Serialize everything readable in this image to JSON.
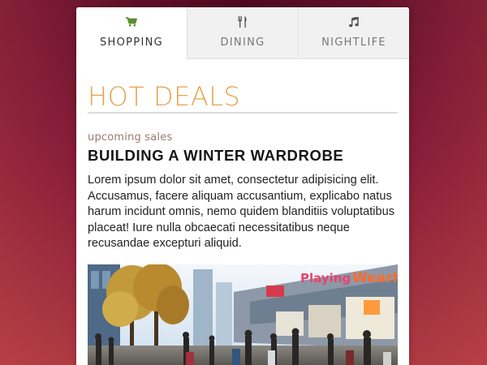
{
  "tabs": [
    {
      "label": "SHOPPING",
      "icon": "shopping-cart-icon",
      "active": true
    },
    {
      "label": "DINING",
      "icon": "fork-knife-icon",
      "active": false
    },
    {
      "label": "NIGHTLIFE",
      "icon": "music-note-icon",
      "active": false
    }
  ],
  "colors": {
    "accent": "#e8a24e",
    "active_icon": "#5a8f2a",
    "background_top": "#5a0a24",
    "background_bottom": "#a6343f"
  },
  "section": {
    "title": "HOT DEALS",
    "subtitle": "upcoming sales",
    "heading": "BUILDING A WINTER WARDROBE",
    "body": "Lorem ipsum dolor sit amet, consectetur adipisicing elit. Accusamus, facere aliquam accusantium, explicabo natus harum incidunt omnis, nemo quidem blanditiis voluptatibus placeat! Iure nulla obcaecati necessitatibus neque recusandae excepturi aliquid."
  },
  "photo": {
    "signs": [
      "Playing",
      "Wearhouse"
    ]
  }
}
